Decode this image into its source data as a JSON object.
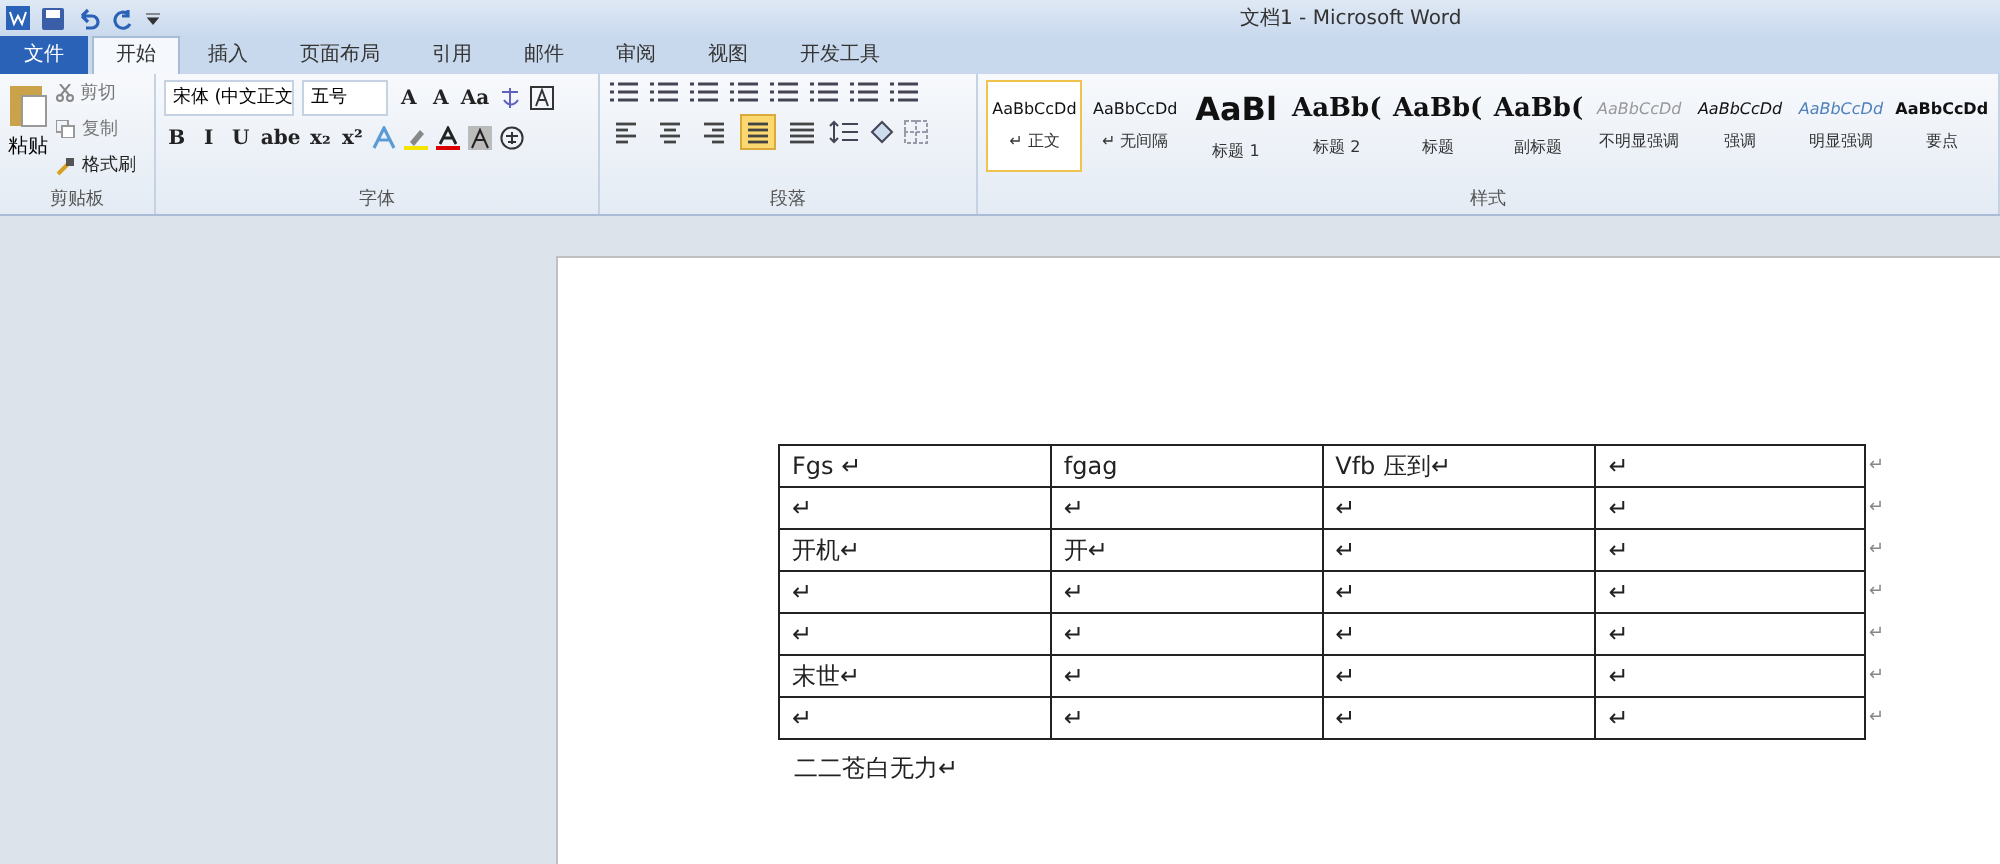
{
  "window": {
    "title": "文档1 - Microsoft Word"
  },
  "tabs": [
    {
      "label": "文件",
      "kind": "file",
      "selected": false
    },
    {
      "label": "开始",
      "kind": "tab",
      "selected": true
    },
    {
      "label": "插入",
      "kind": "tab",
      "selected": false
    },
    {
      "label": "页面布局",
      "kind": "tab",
      "selected": false
    },
    {
      "label": "引用",
      "kind": "tab",
      "selected": false
    },
    {
      "label": "邮件",
      "kind": "tab",
      "selected": false
    },
    {
      "label": "审阅",
      "kind": "tab",
      "selected": false
    },
    {
      "label": "视图",
      "kind": "tab",
      "selected": false
    },
    {
      "label": "开发工具",
      "kind": "tab",
      "selected": false
    }
  ],
  "clipboard": {
    "label": "剪贴板",
    "paste": "粘贴",
    "cut": "剪切",
    "copy": "复制",
    "format_painter": "格式刷"
  },
  "font": {
    "label": "字体",
    "font_name": "宋体 (中文正文",
    "font_size": "五号",
    "row1": [
      "A",
      "A",
      "Aa"
    ],
    "row2": [
      "B",
      "I",
      "U",
      "abe",
      "x₂",
      "x²"
    ]
  },
  "paragraph": {
    "label": "段落",
    "alignments": [
      {
        "kind": "left",
        "selected": false
      },
      {
        "kind": "center",
        "selected": false
      },
      {
        "kind": "right",
        "selected": false
      },
      {
        "kind": "justify",
        "selected": true
      },
      {
        "kind": "distributed",
        "selected": false
      }
    ]
  },
  "styles": {
    "label": "样式",
    "items": [
      {
        "preview": "AaBbCcDd",
        "name": "正文",
        "kind": "normal",
        "marker": "↵",
        "selected": true
      },
      {
        "preview": "AaBbCcDd",
        "name": "无间隔",
        "kind": "normal",
        "marker": "↵",
        "selected": false
      },
      {
        "preview": "AaBl",
        "name": "标题 1",
        "kind": "heading1",
        "selected": false
      },
      {
        "preview": "AaBb(",
        "name": "标题 2",
        "kind": "heading2",
        "selected": false
      },
      {
        "preview": "AaBb(",
        "name": "标题",
        "kind": "heading2",
        "selected": false
      },
      {
        "preview": "AaBb(",
        "name": "副标题",
        "kind": "heading2",
        "selected": false
      },
      {
        "preview": "AaBbCcDd",
        "name": "不明显强调",
        "kind": "subtle",
        "selected": false
      },
      {
        "preview": "AaBbCcDd",
        "name": "强调",
        "kind": "emphasis",
        "selected": false
      },
      {
        "preview": "AaBbCcDd",
        "name": "明显强调",
        "kind": "intense",
        "selected": false
      },
      {
        "preview": "AaBbCcDd",
        "name": "要点",
        "kind": "strong",
        "selected": false
      }
    ]
  },
  "document": {
    "table": {
      "rows": [
        {
          "cells": [
            "Fgs ↵",
            "fgag",
            "Vfb 压到↵",
            "↵"
          ],
          "end": "↵"
        },
        {
          "cells": [
            "↵",
            "↵",
            "↵",
            "↵"
          ],
          "end": "↵"
        },
        {
          "cells": [
            "开机↵",
            "开↵",
            "↵",
            "↵"
          ],
          "end": "↵"
        },
        {
          "cells": [
            "↵",
            "↵",
            "↵",
            "↵"
          ],
          "end": "↵"
        },
        {
          "cells": [
            "↵",
            "↵",
            "↵",
            "↵"
          ],
          "end": "↵"
        },
        {
          "cells": [
            "末世↵",
            "↵",
            "↵",
            "↵"
          ],
          "end": "↵"
        },
        {
          "cells": [
            "↵",
            "↵",
            "↵",
            "↵"
          ],
          "end": "↵"
        }
      ]
    },
    "paragraph": "二二苍白无力↵"
  }
}
